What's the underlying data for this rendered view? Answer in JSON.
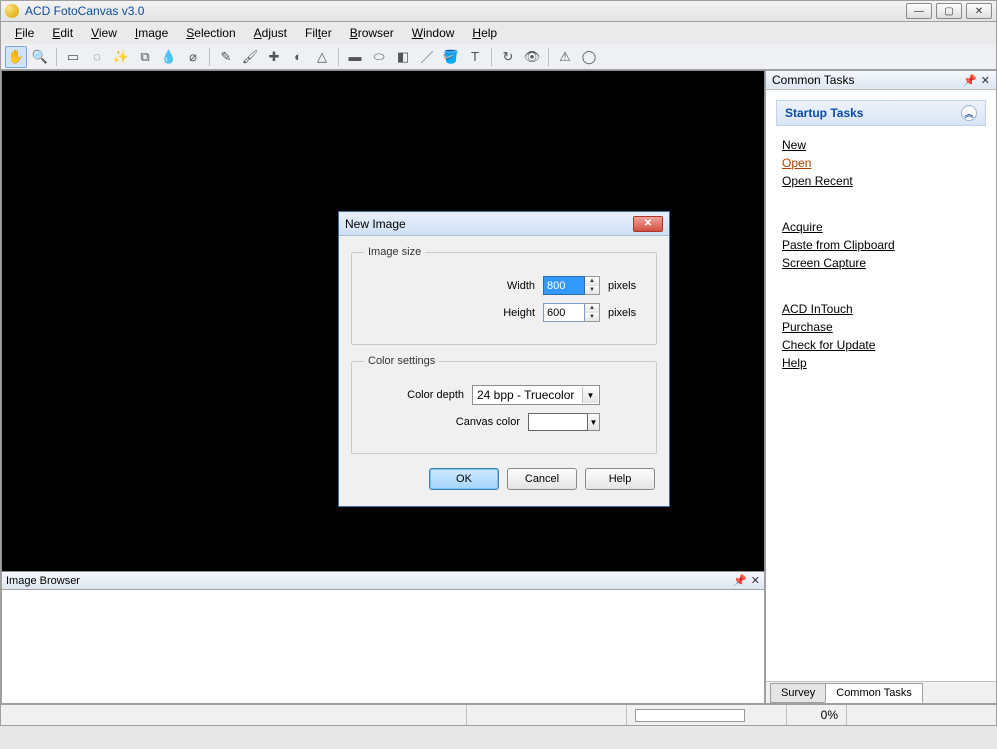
{
  "app": {
    "title": "ACD FotoCanvas v3.0"
  },
  "menu": {
    "file": "File",
    "edit": "Edit",
    "view": "View",
    "image": "Image",
    "selection": "Selection",
    "adjust": "Adjust",
    "filter": "Filter",
    "browser": "Browser",
    "window": "Window",
    "help": "Help"
  },
  "tools": [
    "hand",
    "zoom",
    "marquee",
    "lasso",
    "wand",
    "crop",
    "color-picker",
    "clone",
    "healing",
    "brush",
    "pencil",
    "blur",
    "sharpen",
    "shape-rect",
    "shape-ellipse",
    "gradient",
    "line",
    "paint-bucket",
    "text",
    "rotate",
    "redeye",
    "warning",
    "blur2"
  ],
  "dlg": {
    "title": "New Image",
    "grp_size": "Image size",
    "width_label": "Width",
    "width_value": "800",
    "width_unit": "pixels",
    "height_label": "Height",
    "height_value": "600",
    "height_unit": "pixels",
    "grp_color": "Color settings",
    "depth_label": "Color depth",
    "depth_value": "24 bpp - Truecolor",
    "canvas_label": "Canvas color",
    "canvas_color": "#ffffff",
    "ok": "OK",
    "cancel": "Cancel",
    "help": "Help"
  },
  "right": {
    "title": "Common Tasks",
    "section": "Startup Tasks",
    "links1": {
      "new": "New",
      "open": "Open",
      "openrecent": "Open Recent"
    },
    "links2": {
      "acquire": "Acquire",
      "paste": "Paste from Clipboard",
      "capture": "Screen Capture"
    },
    "links3": {
      "intouch": "ACD InTouch",
      "purchase": "Purchase",
      "update": "Check for Update",
      "help": "Help"
    },
    "tab_survey": "Survey",
    "tab_common": "Common Tasks"
  },
  "imgbrowser": "Image Browser",
  "status": {
    "percent": "0%"
  }
}
